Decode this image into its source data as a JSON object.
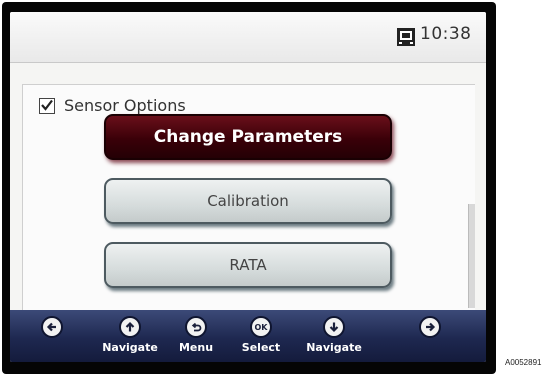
{
  "status_bar": {
    "icon": "device-status-icon",
    "time": "10:38"
  },
  "dialog": {
    "title": "Sensor Options",
    "checkbox_checked": true,
    "buttons": [
      {
        "label": "Change Parameters",
        "selected": true
      },
      {
        "label": "Calibration",
        "selected": false
      },
      {
        "label": "RATA",
        "selected": false
      }
    ]
  },
  "nav_bar": {
    "items": [
      {
        "icon": "left-arrow-icon",
        "label": ""
      },
      {
        "icon": "up-arrow-icon",
        "label": "Navigate"
      },
      {
        "icon": "back-icon",
        "label": "Menu"
      },
      {
        "icon": "ok-icon",
        "label": "Select"
      },
      {
        "icon": "down-arrow-icon",
        "label": "Navigate"
      },
      {
        "icon": "right-arrow-icon",
        "label": ""
      }
    ]
  },
  "figure_code": "A0052891",
  "colors": {
    "selected_button": "#3a0008",
    "nav_bar": "#1e2850",
    "button_border": "#4d5a60"
  }
}
